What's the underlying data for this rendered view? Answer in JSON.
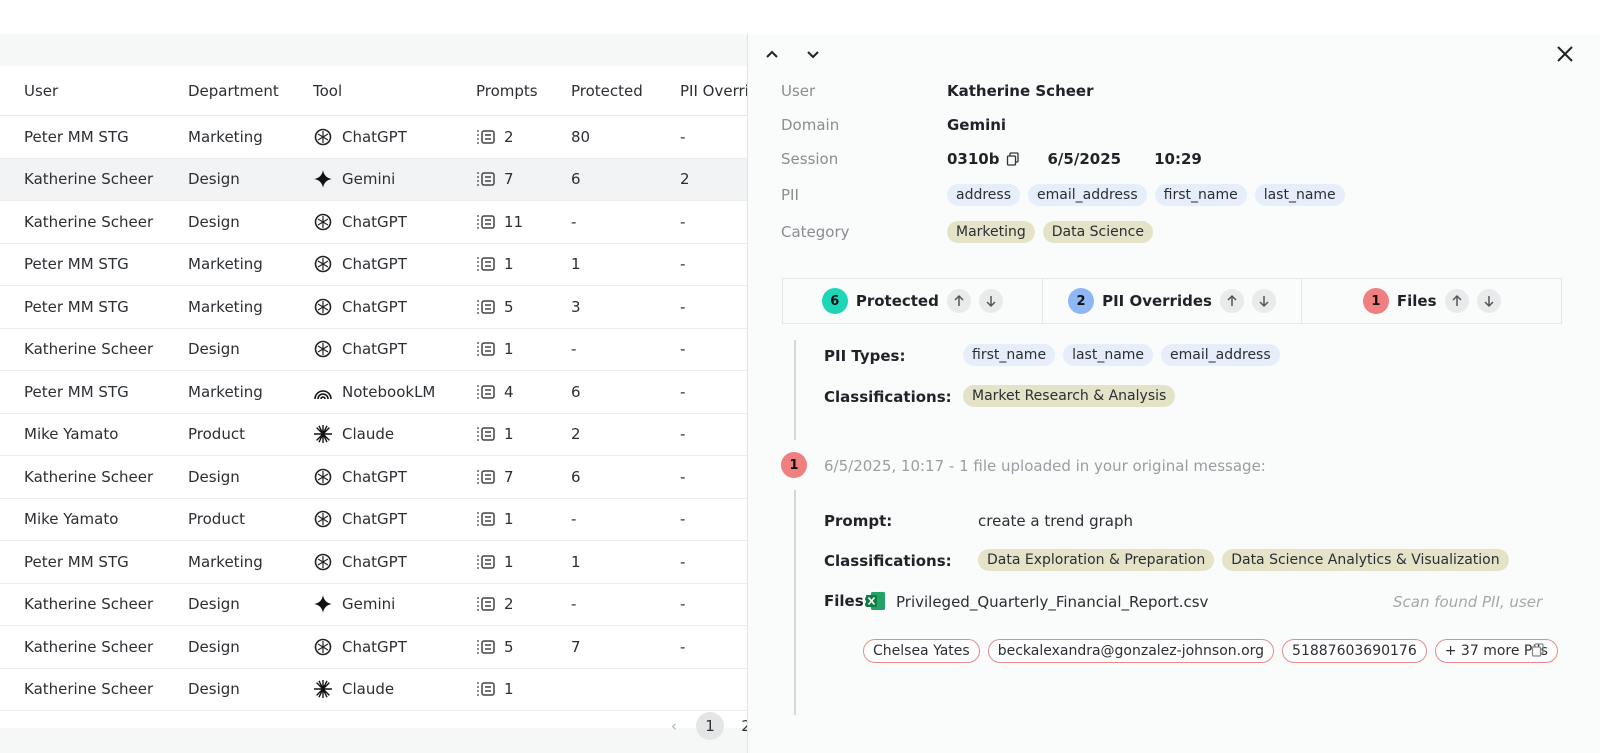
{
  "table": {
    "headers": [
      "User",
      "Department",
      "Tool",
      "Prompts",
      "Protected",
      "PII Overri"
    ],
    "rows": [
      {
        "user": "Peter MM STG",
        "department": "Marketing",
        "tool": "ChatGPT",
        "tool_icon": "chatgpt-icon",
        "prompts": "2",
        "protected": "80",
        "pii": "-"
      },
      {
        "user": "Katherine Scheer",
        "department": "Design",
        "tool": "Gemini",
        "tool_icon": "gemini-icon",
        "prompts": "7",
        "protected": "6",
        "pii": "2",
        "selected": true
      },
      {
        "user": "Katherine Scheer",
        "department": "Design",
        "tool": "ChatGPT",
        "tool_icon": "chatgpt-icon",
        "prompts": "11",
        "protected": "-",
        "pii": "-"
      },
      {
        "user": "Peter MM STG",
        "department": "Marketing",
        "tool": "ChatGPT",
        "tool_icon": "chatgpt-icon",
        "prompts": "1",
        "protected": "1",
        "pii": "-"
      },
      {
        "user": "Peter MM STG",
        "department": "Marketing",
        "tool": "ChatGPT",
        "tool_icon": "chatgpt-icon",
        "prompts": "5",
        "protected": "3",
        "pii": "-"
      },
      {
        "user": "Katherine Scheer",
        "department": "Design",
        "tool": "ChatGPT",
        "tool_icon": "chatgpt-icon",
        "prompts": "1",
        "protected": "-",
        "pii": "-"
      },
      {
        "user": "Peter MM STG",
        "department": "Marketing",
        "tool": "NotebookLM",
        "tool_icon": "notebooklm-icon",
        "prompts": "4",
        "protected": "6",
        "pii": "-"
      },
      {
        "user": "Mike Yamato",
        "department": "Product",
        "tool": "Claude",
        "tool_icon": "claude-icon",
        "prompts": "1",
        "protected": "2",
        "pii": "-"
      },
      {
        "user": "Katherine Scheer",
        "department": "Design",
        "tool": "ChatGPT",
        "tool_icon": "chatgpt-icon",
        "prompts": "7",
        "protected": "6",
        "pii": "-"
      },
      {
        "user": "Mike Yamato",
        "department": "Product",
        "tool": "ChatGPT",
        "tool_icon": "chatgpt-icon",
        "prompts": "1",
        "protected": "-",
        "pii": "-"
      },
      {
        "user": "Peter MM STG",
        "department": "Marketing",
        "tool": "ChatGPT",
        "tool_icon": "chatgpt-icon",
        "prompts": "1",
        "protected": "1",
        "pii": "-"
      },
      {
        "user": "Katherine Scheer",
        "department": "Design",
        "tool": "Gemini",
        "tool_icon": "gemini-icon",
        "prompts": "2",
        "protected": "-",
        "pii": "-"
      },
      {
        "user": "Katherine Scheer",
        "department": "Design",
        "tool": "ChatGPT",
        "tool_icon": "chatgpt-icon",
        "prompts": "5",
        "protected": "7",
        "pii": "-"
      },
      {
        "user": "Katherine Scheer",
        "department": "Design",
        "tool": "Claude",
        "tool_icon": "claude-icon",
        "prompts": "1",
        "protected": "",
        "pii": ""
      }
    ]
  },
  "pagination": {
    "pages": [
      "1",
      "2"
    ],
    "current": "1"
  },
  "panel": {
    "user_label": "User",
    "user_value": "Katherine Scheer",
    "domain_label": "Domain",
    "domain_value": "Gemini",
    "session_label": "Session",
    "session_id": "0310b",
    "session_date": "6/5/2025",
    "session_time": "10:29",
    "pii_label": "PII",
    "pii_chips": [
      "address",
      "email_address",
      "first_name",
      "last_name"
    ],
    "category_label": "Category",
    "category_chips": [
      "Marketing",
      "Data Science"
    ],
    "tabs": [
      {
        "count": "6",
        "label": "Protected",
        "color": "#1dd6b8"
      },
      {
        "count": "2",
        "label": "PII Overrides",
        "color": "#8fb6f5"
      },
      {
        "count": "1",
        "label": "Files",
        "color": "#f07f7f"
      }
    ],
    "section1": {
      "pii_types_label": "PII Types:",
      "pii_types": [
        "first_name",
        "last_name",
        "email_address"
      ],
      "classifications_label": "Classifications:",
      "classifications": [
        "Market Research & Analysis"
      ]
    },
    "event": {
      "badge": "1",
      "text": "6/5/2025, 10:17 - 1 file uploaded in your original message:",
      "prompt_label": "Prompt:",
      "prompt_value": "create a trend graph",
      "classifications_label": "Classifications:",
      "classifications": [
        "Data Exploration & Preparation",
        "Data Science Analytics & Visualization"
      ],
      "files_label": "Files:",
      "file_name": "Privileged_Quarterly_Financial_Report.csv",
      "scan_note": "Scan found PII, user w",
      "pii_found": [
        "Chelsea Yates",
        "beckalexandra@gonzalez-johnson.org",
        "51887603690176",
        "+ 37 more PIIs"
      ]
    }
  }
}
